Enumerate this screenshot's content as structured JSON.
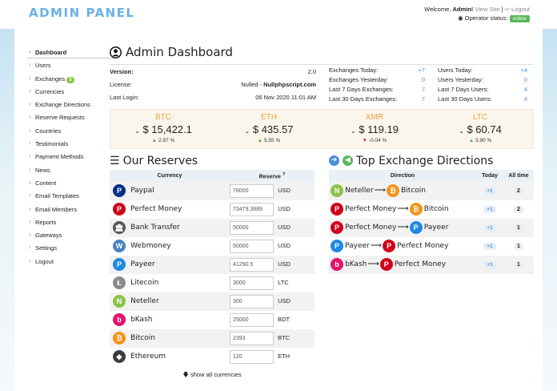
{
  "header": {
    "logo": "ADMIN PANEL",
    "welcome_prefix": "Welcome, ",
    "user": "Admin!",
    "view_site": "View Site",
    "logout": "Logout",
    "operator_label": "Operator status:",
    "operator_status": "online"
  },
  "sidebar": [
    {
      "label": "Dashboard",
      "active": true
    },
    {
      "label": "Users"
    },
    {
      "label": "Exchanges",
      "badge": "3"
    },
    {
      "label": "Currencies"
    },
    {
      "label": "Exchange Directions"
    },
    {
      "label": "Reserve Requests"
    },
    {
      "label": "Countries"
    },
    {
      "label": "Testimonials"
    },
    {
      "label": "Payment Methods"
    },
    {
      "label": "News"
    },
    {
      "label": "Content"
    },
    {
      "label": "Email Templates"
    },
    {
      "label": "Email Members"
    },
    {
      "label": "Reports"
    },
    {
      "label": "Gateways"
    },
    {
      "label": "Settings"
    },
    {
      "label": "Logout"
    }
  ],
  "dashboard": {
    "title": "Admin Dashboard",
    "version_label": "Version:",
    "version": "2.0",
    "license_label": "License:",
    "license_prefix": "Nulled - ",
    "license_site": "Nullphpscript.com",
    "login_label": "Last Login:",
    "login": "06 Nov 2020 11:01 AM",
    "exchanges": [
      {
        "label": "Exchanges Today:",
        "value": "+7"
      },
      {
        "label": "Exchanges Yesterday:",
        "value": "0"
      },
      {
        "label": "Last 7 Days Exchanges:",
        "value": "7"
      },
      {
        "label": "Last 30 Days Exchanges:",
        "value": "7"
      }
    ],
    "users": [
      {
        "label": "Users Today:",
        "value": "+4"
      },
      {
        "label": "Users Yesterday:",
        "value": "0"
      },
      {
        "label": "Last 7 Days Users:",
        "value": "4"
      },
      {
        "label": "Last 30 Days Users:",
        "value": "4"
      }
    ]
  },
  "coins": [
    {
      "name": "BTC",
      "price": "$ 15,422.1",
      "change": "2.97 %",
      "dir": "up"
    },
    {
      "name": "ETH",
      "price": "$ 435.57",
      "change": "5.55 %",
      "dir": "up"
    },
    {
      "name": "XMR",
      "price": "$ 119.19",
      "change": "-0.04 %",
      "dir": "down"
    },
    {
      "name": "LTC",
      "price": "$ 60.74",
      "change": "3.90 %",
      "dir": "up"
    }
  ],
  "reserves": {
    "title": "Our Reserves",
    "col_currency": "Currency",
    "col_reserve": "Reserve",
    "show_all": "show all currencies",
    "rows": [
      {
        "name": "Paypal",
        "value": "78000",
        "unit": "USD",
        "icon": "paypal-icon",
        "color": "#003087",
        "glyph": "P"
      },
      {
        "name": "Perfect Money",
        "value": "73479.3889",
        "unit": "USD",
        "icon": "perfect-money-icon",
        "color": "#d0021b",
        "glyph": "P"
      },
      {
        "name": "Bank Transfer",
        "value": "50000",
        "unit": "USD",
        "icon": "bank-icon",
        "color": "#555555",
        "glyph": "🏛"
      },
      {
        "name": "Webmoney",
        "value": "50000",
        "unit": "USD",
        "icon": "webmoney-icon",
        "color": "#4a7fc1",
        "glyph": "W"
      },
      {
        "name": "Payeer",
        "value": "41290.5",
        "unit": "USD",
        "icon": "payeer-icon",
        "color": "#1e88e5",
        "glyph": "P"
      },
      {
        "name": "Litecoin",
        "value": "3000",
        "unit": "LTC",
        "icon": "litecoin-icon",
        "color": "#8a8a8a",
        "glyph": "Ł"
      },
      {
        "name": "Neteller",
        "value": "300",
        "unit": "USD",
        "icon": "neteller-icon",
        "color": "#8bc34a",
        "glyph": "N"
      },
      {
        "name": "bKash",
        "value": "25000",
        "unit": "BDT",
        "icon": "bkash-icon",
        "color": "#e2136e",
        "glyph": "b"
      },
      {
        "name": "Bitcoin",
        "value": "2393",
        "unit": "BTC",
        "icon": "bitcoin-icon",
        "color": "#f7931a",
        "glyph": "₿"
      },
      {
        "name": "Ethereum",
        "value": "120",
        "unit": "ETH",
        "icon": "ethereum-icon",
        "color": "#3c3c3d",
        "glyph": "◆"
      }
    ]
  },
  "directions": {
    "title": "Top Exchange Directions",
    "col_direction": "Direction",
    "col_today": "Today",
    "col_all": "All time",
    "rows": [
      {
        "from": "Neteller",
        "from_color": "#8bc34a",
        "from_glyph": "N",
        "to": "Bitcoin",
        "to_color": "#f7931a",
        "to_glyph": "₿",
        "today": "+1",
        "all": "2"
      },
      {
        "from": "Perfect Money",
        "from_color": "#d0021b",
        "from_glyph": "P",
        "to": "Bitcoin",
        "to_color": "#f7931a",
        "to_glyph": "₿",
        "today": "+1",
        "all": "2"
      },
      {
        "from": "Perfect Money",
        "from_color": "#d0021b",
        "from_glyph": "P",
        "to": "Payeer",
        "to_color": "#1e88e5",
        "to_glyph": "P",
        "today": "+1",
        "all": "1"
      },
      {
        "from": "Payeer",
        "from_color": "#1e88e5",
        "from_glyph": "P",
        "to": "Perfect Money",
        "to_color": "#d0021b",
        "to_glyph": "P",
        "today": "+1",
        "all": "1"
      },
      {
        "from": "bKash",
        "from_color": "#e2136e",
        "from_glyph": "b",
        "to": "Perfect Money",
        "to_color": "#d0021b",
        "to_glyph": "P",
        "today": "+1",
        "all": "1"
      }
    ]
  }
}
